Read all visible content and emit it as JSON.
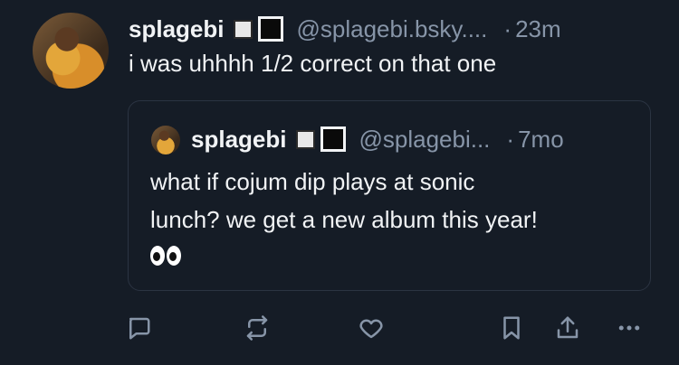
{
  "post": {
    "author_name": "splagebi",
    "author_handle": "@splagebi.bsky....",
    "time_sep": "·",
    "time": "23m",
    "text": "i was uhhhh 1/2 correct on that one"
  },
  "quoted_post": {
    "author_name": "splagebi",
    "author_handle": "@splagebi...",
    "time_sep": "·",
    "time": "7mo",
    "text_line1": "what if cojum dip plays at sonic",
    "text_line2": "lunch? we get a new album this year!",
    "emoji": "eyes-emoji"
  },
  "actions": {
    "icons": [
      "reply-icon",
      "repost-icon",
      "like-icon",
      "bookmark-icon",
      "share-icon",
      "more-icon"
    ],
    "icon_color": "#8795a8"
  },
  "colors": {
    "background": "#151c26",
    "text": "#f1f3f5",
    "muted": "#8795a8",
    "border": "#2b3442"
  }
}
